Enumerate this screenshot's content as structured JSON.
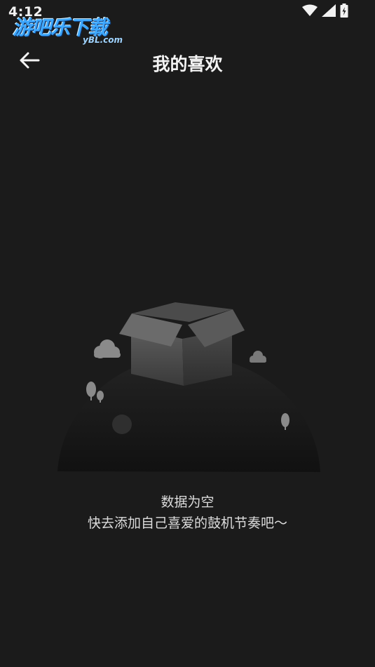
{
  "status_bar": {
    "time": "4:12",
    "icons": [
      "wifi-icon",
      "signal-icon",
      "battery-icon"
    ]
  },
  "watermark": {
    "main": "游吧乐下载",
    "sub": "yBL.com"
  },
  "header": {
    "back_icon": "arrow-left-icon",
    "title": "我的喜欢"
  },
  "empty_state": {
    "title": "数据为空",
    "subtitle": "快去添加自己喜爱的鼓机节奏吧～"
  },
  "colors": {
    "background": "#1b1b1b",
    "text_primary": "#f4f4f4",
    "text_secondary": "#dcdcdc",
    "watermark_blue": "#3ea8ff"
  }
}
